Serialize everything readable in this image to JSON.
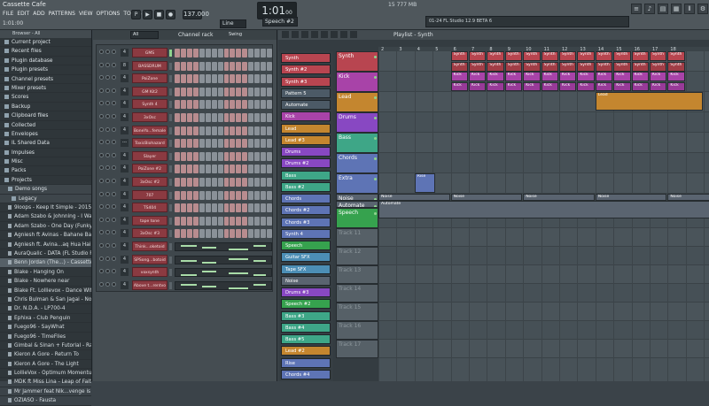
{
  "app": {
    "title": "Cassette Cafe",
    "menu": [
      "FILE",
      "EDIT",
      "ADD",
      "PATTERNS",
      "VIEW",
      "OPTIONS",
      "TOOLS",
      "?"
    ],
    "time_small": "1:01:00",
    "tempo": "137.000",
    "song_time": "1:01",
    "song_time_sub": "00",
    "pattern": "Speech #2",
    "line_mode": "Line",
    "cpu": "15",
    "mem": "777 MB",
    "hint": "01-24  FL Studio 12.9 BETA 6"
  },
  "browser": {
    "header": "Browser - All",
    "items": [
      {
        "label": "Current project",
        "type": "folder"
      },
      {
        "label": "Recent files",
        "type": "folder"
      },
      {
        "label": "Plugin database",
        "type": "folder"
      },
      {
        "label": "Plugin presets",
        "type": "folder"
      },
      {
        "label": "Channel presets",
        "type": "folder"
      },
      {
        "label": "Mixer presets",
        "type": "folder"
      },
      {
        "label": "Scores",
        "type": "folder"
      },
      {
        "label": "Backup",
        "type": "folder"
      },
      {
        "label": "Clipboard files",
        "type": "folder"
      },
      {
        "label": "Collected",
        "type": "folder"
      },
      {
        "label": "Envelopes",
        "type": "folder"
      },
      {
        "label": "IL Shared Data",
        "type": "folder"
      },
      {
        "label": "Impulses",
        "type": "folder"
      },
      {
        "label": "Misc",
        "type": "folder"
      },
      {
        "label": "Packs",
        "type": "folder"
      },
      {
        "label": "Projects",
        "type": "folder"
      },
      {
        "label": "Demo songs",
        "type": "folder"
      },
      {
        "label": "Legacy",
        "type": "folder"
      },
      {
        "label": "9loops - Keep It Simple - 2015",
        "type": "file"
      },
      {
        "label": "Adam Szabo & Johnning - I Wanna Be",
        "type": "file"
      },
      {
        "label": "Adam Szabo - One Day (Funky Mix)",
        "type": "file"
      },
      {
        "label": "Agniesh ft Avinas - Bahane Bana Kar",
        "type": "file"
      },
      {
        "label": "Agniesh ft. Avina...aq Hua Hai Mujhe",
        "type": "file"
      },
      {
        "label": "AuraQualic - DATA (FL Studio Remix)",
        "type": "file"
      },
      {
        "label": "Benn Jordan (The...) - Cassette Cafe",
        "type": "file"
      },
      {
        "label": "Blake - Hanging On",
        "type": "file"
      },
      {
        "label": "Blake - Nowhere near",
        "type": "file"
      },
      {
        "label": "Blake Ft. Lollievox - Dance With Me",
        "type": "file"
      },
      {
        "label": "Chris Bulman & San Jagai - No Escape",
        "type": "file"
      },
      {
        "label": "Dr. N.D.A. - LP700-4",
        "type": "file"
      },
      {
        "label": "Ephixa - Club Penguin",
        "type": "file"
      },
      {
        "label": "Fuego96 - SayWhat",
        "type": "file"
      },
      {
        "label": "Fuego96 - TimeFlies",
        "type": "file"
      },
      {
        "label": "Gimbal & Sinan + Futorial - RawFL",
        "type": "file"
      },
      {
        "label": "Kieron A Gore - Return To",
        "type": "file"
      },
      {
        "label": "Kieron A Gore - The Light",
        "type": "file"
      },
      {
        "label": "LollieVox - Optimum Momentum",
        "type": "file"
      },
      {
        "label": "MDK ft Miss Lina - Leap of Faith",
        "type": "file"
      },
      {
        "label": "Mr Jammer feat Nik...venge is sweet",
        "type": "file"
      },
      {
        "label": "OZIASO - Fausta",
        "type": "file"
      }
    ]
  },
  "channel_rack": {
    "filter": "All",
    "title": "Channel rack",
    "swing_label": "Swing",
    "channels": [
      {
        "num": "4",
        "name": "GMS",
        "mode": "steps"
      },
      {
        "num": "8",
        "name": "BASSDRUM",
        "mode": "steps"
      },
      {
        "num": "4",
        "name": "PoiZone",
        "mode": "steps"
      },
      {
        "num": "4",
        "name": "GM Kit2",
        "mode": "steps"
      },
      {
        "num": "4",
        "name": "Synth 4",
        "mode": "steps"
      },
      {
        "num": "4",
        "name": "3xOsc",
        "mode": "steps"
      },
      {
        "num": "4",
        "name": "BoneYo...female",
        "mode": "steps"
      },
      {
        "num": "---",
        "name": "ToxicBiohazard",
        "mode": "steps"
      },
      {
        "num": "4",
        "name": "Slayer",
        "mode": "steps"
      },
      {
        "num": "4",
        "name": "PoiZone #2",
        "mode": "steps"
      },
      {
        "num": "4",
        "name": "3xOsc #2",
        "mode": "steps"
      },
      {
        "num": "4",
        "name": "707",
        "mode": "steps"
      },
      {
        "num": "4",
        "name": "TS404",
        "mode": "steps"
      },
      {
        "num": "4",
        "name": "tape tone",
        "mode": "steps"
      },
      {
        "num": "4",
        "name": "3xOsc #3",
        "mode": "steps"
      },
      {
        "num": "4",
        "name": "Think...oketoid",
        "mode": "roll"
      },
      {
        "num": "4",
        "name": "SPSong...botoid",
        "mode": "roll"
      },
      {
        "num": "4",
        "name": "voxsynth",
        "mode": "roll"
      },
      {
        "num": "4",
        "name": "Above t...rentvo",
        "mode": "roll"
      }
    ]
  },
  "playlist": {
    "title": "Playlist - Synth",
    "ruler": [
      "2",
      "3",
      "4",
      "5",
      "6",
      "7",
      "8",
      "9",
      "10",
      "11",
      "12",
      "13",
      "14",
      "15",
      "16",
      "17",
      "18"
    ],
    "picker": [
      {
        "label": "Synth",
        "color": "#b84550"
      },
      {
        "label": "Synth #2",
        "color": "#b84550"
      },
      {
        "label": "Synth #3",
        "color": "#b84550"
      },
      {
        "label": "Pattern 5",
        "color": "#4c5a66"
      },
      {
        "label": "Automate",
        "color": "#4c5a66"
      },
      {
        "label": "Kick",
        "color": "#a843a8"
      },
      {
        "label": "Lead",
        "color": "#c4862f"
      },
      {
        "label": "Lead #3",
        "color": "#c4862f"
      },
      {
        "label": "Drums",
        "color": "#8848c2"
      },
      {
        "label": "Drums #2",
        "color": "#8848c2"
      },
      {
        "label": "Bass",
        "color": "#3ea687"
      },
      {
        "label": "Bass #2",
        "color": "#3ea687"
      },
      {
        "label": "Chords",
        "color": "#5e74b5"
      },
      {
        "label": "Chords #2",
        "color": "#5e74b5"
      },
      {
        "label": "Chords #3",
        "color": "#5e74b5"
      },
      {
        "label": "Synth 4",
        "color": "#5e74b5"
      },
      {
        "label": "Speech",
        "color": "#36a24e"
      },
      {
        "label": "Guitar SFX",
        "color": "#4c8eb5"
      },
      {
        "label": "Tape SFX",
        "color": "#4c8eb5"
      },
      {
        "label": "Noise",
        "color": "#5a6470"
      },
      {
        "label": "Drums #3",
        "color": "#8848c2"
      },
      {
        "label": "Speech #2",
        "color": "#36a24e"
      },
      {
        "label": "Bass #3",
        "color": "#3ea687"
      },
      {
        "label": "Bass #4",
        "color": "#3ea687"
      },
      {
        "label": "Bass #5",
        "color": "#3ea687"
      },
      {
        "label": "Lead #2",
        "color": "#c4862f"
      },
      {
        "label": "Rise",
        "color": "#5e74b5"
      },
      {
        "label": "Chords #4",
        "color": "#5e74b5"
      }
    ],
    "tracks": [
      {
        "label": "Synth",
        "color": "#b84550"
      },
      {
        "label": "Kick",
        "color": "#a843a8"
      },
      {
        "label": "Lead",
        "color": "#c4862f"
      },
      {
        "label": "Drums",
        "color": "#8848c2"
      },
      {
        "label": "Bass",
        "color": "#3ea687"
      },
      {
        "label": "Chords",
        "color": "#5e74b5"
      },
      {
        "label": "Extra",
        "color": "#5e74b5"
      },
      {
        "label": "Noise",
        "color": "#5a6470"
      },
      {
        "label": "Automate",
        "color": "#5a6470"
      },
      {
        "label": "Speech",
        "color": "#36a24e"
      },
      {
        "label": "Track 11",
        "color": "#566067"
      },
      {
        "label": "Track 12",
        "color": "#566067"
      },
      {
        "label": "Track 13",
        "color": "#566067"
      },
      {
        "label": "Track 14",
        "color": "#566067"
      },
      {
        "label": "Track 15",
        "color": "#566067"
      },
      {
        "label": "Track 16",
        "color": "#566067"
      },
      {
        "label": "Track 17",
        "color": "#566067"
      }
    ],
    "clip_labels": {
      "synth": "Synth",
      "kick": "Kick",
      "lead": "Lead",
      "noise": "Noise",
      "automate": "Automate",
      "rise": "Rise"
    }
  }
}
